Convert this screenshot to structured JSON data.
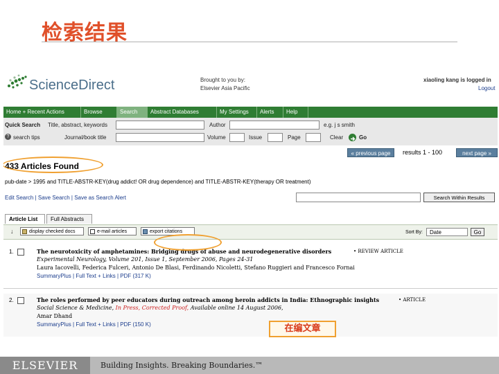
{
  "slide": {
    "title": "检索结果",
    "callout_text": "在编文章"
  },
  "sd": {
    "logo_text": "ScienceDirect",
    "brought_by_line1": "Brought to you by:",
    "brought_by_line2": "Elsevier Asia Pacific",
    "user_text": "xiaoling kang is logged in",
    "logout_link": "Logout",
    "nav": [
      "Home + Recent Actions",
      "Browse",
      "Search",
      "Abstract Databases",
      "My Settings",
      "Alerts",
      "Help"
    ],
    "quick_search_label": "Quick Search",
    "title_abstract_label": "Title, abstract, keywords",
    "author_label": "Author",
    "examples_label": "e.g. j s smith",
    "search_tips_label": "search tips",
    "journal_book_label": "Journal/book title",
    "volume_label": "Volume",
    "issue_label": "Issue",
    "page_label": "Page",
    "clear_label": "Clear",
    "go_label": "Go",
    "prev_page_label": "« previous page",
    "results_label": "results 1 - 100",
    "next_page_label": "next page »",
    "found_text": "433 Articles Found",
    "query_text": "pub-date > 1995 and TITLE-ABSTR-KEY(drug addict! OR drug dependence) and TITLE-ABSTR-KEY(therapy OR treatment)",
    "edit_links": "Edit Search | Save Search | Save as Search Alert",
    "search_within_label": "Search Within Results",
    "tabs": [
      "Article List",
      "Full Abstracts"
    ],
    "toolbar": {
      "display_checked": "display checked docs",
      "email_articles": "e-mail articles",
      "export_citations": "export citations"
    },
    "sort_by_label": "Sort By:",
    "sort_value": "Date",
    "sort_go": "Go",
    "results": [
      {
        "num": "1.",
        "title": "The neurotoxicity of amphetamines: Bridging drugs of abuse and neurodegenerative disorders",
        "type": "• REVIEW ARTICLE",
        "source": "Experimental Neurology, Volume 201, Issue 1, September 2006, Pages 24-31",
        "authors": "Laura Iacovelli, Federica Fulceri, Antonio De Blasi, Ferdinando Nicoletti, Stefano Ruggieri and Francesco Fornai",
        "links": "SummaryPlus | Full Text + Links | PDF (317 K)"
      },
      {
        "num": "2.",
        "title": "The roles performed by peer educators during outreach among heroin addicts in India: Ethnographic insights",
        "type": "• ARTICLE",
        "source_italic": "Social Science & Medicine,",
        "source_red": "In Press, Corrected Proof,",
        "source_tail": "Available online 14 August 2006,",
        "authors": "Amar Dhand",
        "links": "SummaryPlus | Full Text + Links | PDF (150 K)"
      }
    ]
  },
  "footer": {
    "logo": "ELSEVIER",
    "tagline": "Building Insights. Breaking Boundaries.™"
  },
  "colors": {
    "title_red": "#e0502a",
    "nav_green": "#2f7d33",
    "highlight_orange": "#f0a030",
    "proof_red": "#cc2020"
  }
}
